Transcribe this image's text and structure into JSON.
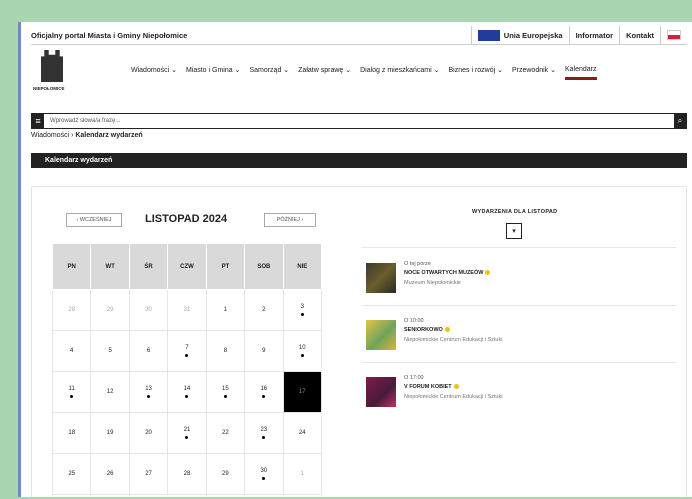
{
  "topbar": {
    "portal_title": "Oficjalny portal Miasta i Gminy Niepołomice",
    "eu_label": "Unia Europejska",
    "informator": "Informator",
    "kontakt": "Kontakt"
  },
  "logo_text": "NIEPOŁOMICE",
  "nav": [
    "Wiadomości ⌄",
    "Miasto i Gmina ⌄",
    "Samorząd ⌄",
    "Załatw sprawę ⌄",
    "Dialog z mieszkańcami ⌄",
    "Biznes i rozwój ⌄",
    "Przewodnik ⌄",
    "Kalendarz"
  ],
  "search": {
    "placeholder": "Wprowadź słowa/a frazę..."
  },
  "breadcrumb": {
    "parent": "Wiadomości",
    "sep": " › ",
    "current": "Kalendarz wydarzeń"
  },
  "section_title": "Kalendarz wydarzeń",
  "calendar": {
    "prev_label": "‹ WCZEŚNIEJ",
    "next_label": "PÓŹNIEJ ›",
    "month_title": "LISTOPAD 2024",
    "weekdays": [
      "PN",
      "WT",
      "ŚR",
      "CZW",
      "PT",
      "SOB",
      "NIE"
    ]
  },
  "events_panel": {
    "heading": "WYDARZENIA DLA LISTOPAD",
    "toggle": "▾",
    "events": [
      {
        "time": "O tej porze",
        "title": "NOCE OTWARTYCH MUZEÓW",
        "location": "Muzeum Niepołomickie"
      },
      {
        "time": "O 10:00",
        "title": "SENIORKOWO",
        "location": "Niepołomickie Centrum Edukacji i Sztuki"
      },
      {
        "time": "O 17:00",
        "title": "V FORUM KOBIET",
        "location": "Niepołomickie Centrum Edukacji i Sztuki"
      }
    ]
  }
}
